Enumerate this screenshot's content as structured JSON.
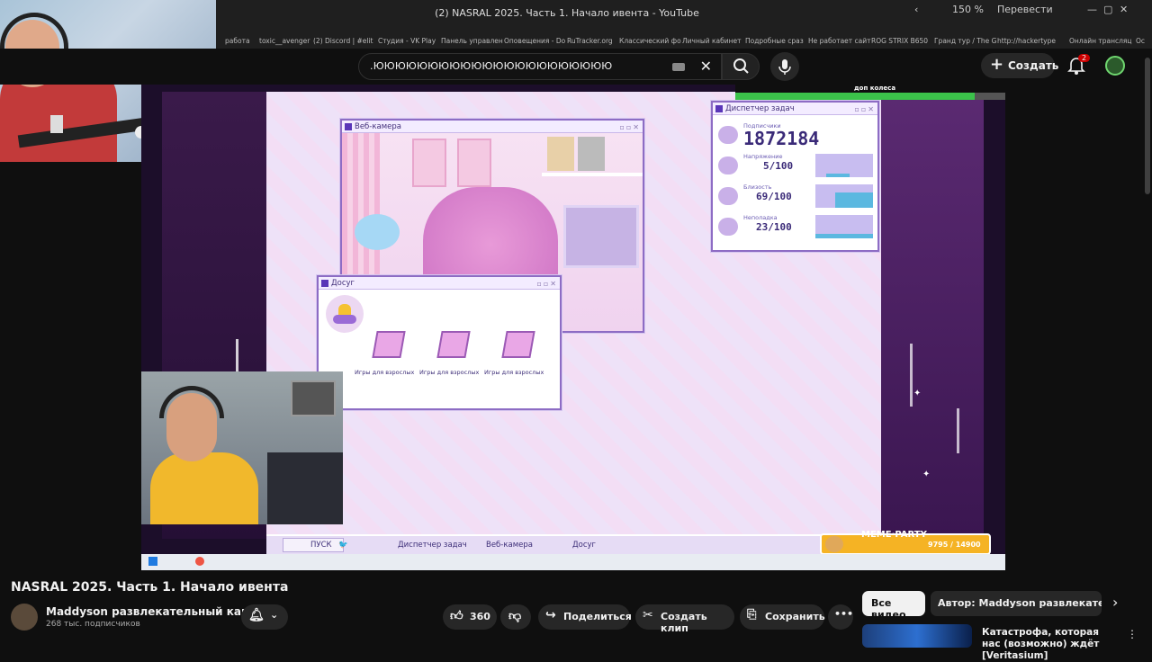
{
  "browser": {
    "tab_title": "(2) NASRAL 2025. Часть 1. Начало ивента - YouTube",
    "zoom": "150 %",
    "translate": "Перевести",
    "bookmarks": [
      "работа",
      "toxic__avenger",
      "(2) Discord | #elit",
      "Студия - VK Play",
      "Панель управлен",
      "Оповещения - Do",
      "RuTracker.org",
      "Классический фо",
      "Личный кабинет",
      "Подробные сраз",
      "Не работает сайт",
      "ROG STRIX B650",
      "Гранд тур / The G",
      "http://hackertype",
      "Онлайн трансляц",
      "Ос"
    ]
  },
  "youtube": {
    "search_query": ".ЮЮЮЮЮЮЮЮЮЮЮЮЮЮЮЮЮЮЮЮЮЮ",
    "create_label": "Создать",
    "notif_count": "2",
    "video_title": "NASRAL 2025. Часть 1. Начало ивента",
    "channel_name": "Maddyson развлекательный канал",
    "subscribers": "268 тыс. подписчиков",
    "likes": "360",
    "share": "Поделиться",
    "clip": "Создать клип",
    "save": "Сохранить",
    "chip_all": "Все видео",
    "chip_author": "Автор: Maddyson развлекательный",
    "rec_title": "Катастрофа, которая нас (возможно) ждёт [Veritasium]"
  },
  "game": {
    "dop_label": "доп колеса",
    "webcam_title": "Веб-камера",
    "dosug_title": "Досуг",
    "dosug_items": [
      "Игры для взрослых",
      "Игры для взрослых",
      "Игры для взрослых"
    ],
    "tm_title": "Диспетчер задач",
    "tm_rows": [
      {
        "label": "Подписчики",
        "value": "1872184",
        "size": 22
      },
      {
        "label": "Напряжение",
        "value": "5/100",
        "size": 12,
        "level": 0.15
      },
      {
        "label": "Близость",
        "value": "69/100",
        "size": 12,
        "level": 0.7
      },
      {
        "label": "Неполадка",
        "value": "23/100",
        "size": 12,
        "level": 0.4
      }
    ],
    "start": "ПУСК",
    "taskbar_items": [
      "Диспетчер задач",
      "Веб-камера",
      "Досуг"
    ],
    "meme_label": "MEME·PARTY",
    "meme_count": "9795 / 14900"
  },
  "colors": {
    "accent": "#8d6cc4",
    "bg": "#0f0f0f",
    "like": "#f1f1f1"
  }
}
